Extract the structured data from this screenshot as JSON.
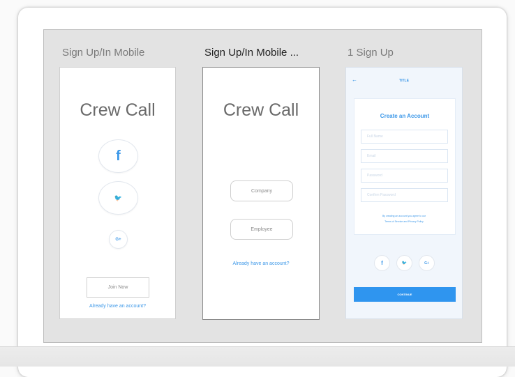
{
  "artboards": [
    {
      "title": "Sign Up/In Mobile",
      "app_title": "Crew Call",
      "social_icons": [
        "facebook-icon",
        "twitter-icon",
        "google-plus-icon"
      ],
      "social_glyphs": {
        "facebook": "f",
        "twitter": "🐦",
        "google": "G+"
      },
      "join_button": "Join Now",
      "account_link": "Already have an account?"
    },
    {
      "title": "Sign Up/In Mobile ...",
      "app_title": "Crew Call",
      "company_button": "Company",
      "employee_button": "Employee",
      "account_link": "Already have an account?"
    },
    {
      "title": "1 Sign Up",
      "header_title": "TITLE",
      "back_glyph": "←",
      "card_title": "Create an Account",
      "fields": {
        "full_name": "Full Name",
        "email": "Email",
        "password": "Password",
        "confirm_password": "Confirm Password"
      },
      "terms_line1": "By creating an account you agree to our",
      "terms_line2": "Terms of Service and Privacy Policy",
      "continue_button": "CONTINUE"
    }
  ],
  "colors": {
    "accent": "#3b97e8",
    "canvas": "#e3e3e3",
    "signup_background": "#f1f6fc"
  }
}
